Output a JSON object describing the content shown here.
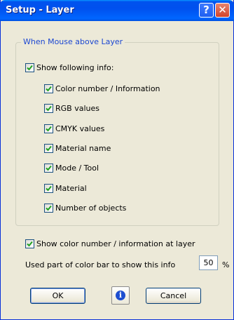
{
  "window": {
    "title": "Setup - Layer"
  },
  "titlebar": {
    "help_glyph": "?",
    "close_glyph": "✕"
  },
  "group": {
    "legend": "When Mouse above Layer"
  },
  "checkboxes": {
    "show_info": {
      "label": "Show following info:",
      "checked": true
    },
    "color_number": {
      "label": "Color number / Information",
      "checked": true
    },
    "rgb": {
      "label": "RGB values",
      "checked": true
    },
    "cmyk": {
      "label": "CMYK values",
      "checked": true
    },
    "material_name": {
      "label": "Material name",
      "checked": true
    },
    "mode_tool": {
      "label": "Mode / Tool",
      "checked": true
    },
    "material": {
      "label": "Material",
      "checked": true
    },
    "num_objects": {
      "label": "Number of objects",
      "checked": true
    },
    "show_at_layer": {
      "label": "Show color number / information at layer",
      "checked": true
    }
  },
  "color_bar": {
    "label": "Used part of color bar to show this info",
    "value": "50",
    "unit": "%"
  },
  "buttons": {
    "ok": "OK",
    "info_glyph": "i",
    "cancel": "Cancel"
  }
}
